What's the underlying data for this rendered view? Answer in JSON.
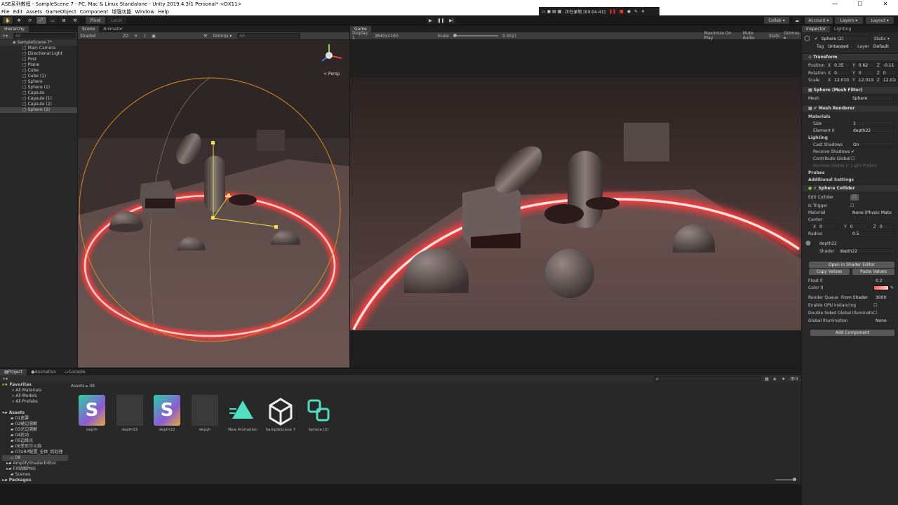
{
  "window": {
    "title": "ASE系列教程 - SampleScene 7 - PC, Mac & Linux Standalone - Unity 2019.4.3f1 Personal* <DX11>",
    "min": "—",
    "max": "☐",
    "close": "✕"
  },
  "menu": [
    "File",
    "Edit",
    "Assets",
    "GameObject",
    "Component",
    "增强功能",
    "Window",
    "Help"
  ],
  "recording": {
    "text": "正在录制 [00:04:43]"
  },
  "toolbar": {
    "pivot": "Pivot",
    "local": "Local",
    "collab": "Collab ▾",
    "account": "Account ▾",
    "layers": "Layers ▾",
    "layout": "Layout ▾"
  },
  "hierarchy": {
    "tab": "Hierarchy",
    "search_placeholder": "All",
    "scene": "SampleScene 7*",
    "items": [
      "Main Camera",
      "Directional Light",
      "Post",
      "Plane",
      "Cube",
      "Cube (1)",
      "Sphere",
      "Sphere (1)",
      "Capsule",
      "Capsule (1)",
      "Capsule (2)",
      "Sphere (2)"
    ]
  },
  "scene": {
    "tabs": [
      "Scene",
      "Animator"
    ],
    "shading": "Shaded",
    "mode": "2D",
    "gizmos": "Gizmos ▾",
    "search_placeholder": "All",
    "persp": "< Persp"
  },
  "game": {
    "tab": "Game",
    "display": "Display 1",
    "resolution": "3840x2160",
    "scale_label": "Scale",
    "scale_value": "0.502)",
    "maximize": "Maximize On Play",
    "mute": "Mute Audio",
    "stats": "Stats",
    "gizmos": "Gizmos ▾"
  },
  "inspector": {
    "tabs": [
      "Inspector",
      "Lighting"
    ],
    "object_name": "Sphere (2)",
    "static": "Static ▾",
    "tag_label": "Tag",
    "tag": "Untagged",
    "layer_label": "Layer",
    "layer": "Default",
    "transform": {
      "title": "Transform",
      "position_label": "Position",
      "px": "0.35",
      "py": "0.62",
      "pz": "-0.11",
      "rotation_label": "Rotation",
      "rx": "0",
      "ry": "0",
      "rz": "0",
      "scale_label": "Scale",
      "sx": "12.010:",
      "sy": "12.010:",
      "sz": "12.010:",
      "x": "X",
      "y": "Y",
      "z": "Z"
    },
    "mesh_filter": {
      "title": "Sphere (Mesh Filter)",
      "mesh_label": "Mesh",
      "mesh": "Sphere"
    },
    "mesh_renderer": {
      "title": "Mesh Renderer",
      "materials": "Materials",
      "size_label": "Size",
      "size": "1",
      "element_label": "Element 0",
      "element": "depth22",
      "lighting": "Lighting",
      "cast_label": "Cast Shadows",
      "cast": "On",
      "receive_label": "Receive Shadows",
      "contrib_label": "Contribute Global",
      "receive_gi_label": "Receive Global Il",
      "receive_gi": "Light Probes",
      "probes": "Probes",
      "additional": "Additional Settings"
    },
    "collider": {
      "title": "Sphere Collider",
      "edit_label": "Edit Collider",
      "trigger_label": "Is Trigger",
      "material_label": "Material",
      "material": "None (Physic Mate",
      "center_label": "Center",
      "cx": "0",
      "cy": "0",
      "cz": "0",
      "radius_label": "Radius",
      "radius": "0.5"
    },
    "material": {
      "name": "depth22",
      "shader_label": "Shader",
      "shader": "depth22",
      "open_editor": "Open in Shader Editor",
      "copy": "Copy Values",
      "paste": "Paste Values",
      "float_label": "Float 0",
      "float_val": "0.2",
      "color_label": "Color 0",
      "rq_label": "Render Queue",
      "rq_mode": "From Shader",
      "rq_val": "3000",
      "gpu_label": "Enable GPU Instancing",
      "double_label": "Double Sided Global Illuminatio",
      "gi_label": "Global Illumination",
      "gi": "None"
    },
    "add_component": "Add Component"
  },
  "project": {
    "tabs": [
      "Project",
      "Animation",
      "Console"
    ],
    "favorites": "Favorites",
    "fav_items": [
      "All Materials",
      "All Models",
      "All Prefabs"
    ],
    "assets": "Assets",
    "folders": [
      "01遮罩",
      "02硬边溶解",
      "03光边溶解",
      "04扰动",
      "05边缘光",
      "06菲尼尔火焰",
      "07URP配置_全体_后处理",
      "08",
      "AmplifyShaderEditor",
      "FX贴图PNG",
      "Scenes"
    ],
    "packages": "Packages",
    "breadcrumb": [
      "Assets",
      "08"
    ],
    "count": "9",
    "files": [
      {
        "name": "depth",
        "kind": "shader"
      },
      {
        "name": "depth22",
        "kind": "material"
      },
      {
        "name": "depth22",
        "kind": "shader"
      },
      {
        "name": "depyh",
        "kind": "material"
      },
      {
        "name": "New Animation",
        "kind": "animation"
      },
      {
        "name": "SampleScene 7",
        "kind": "unity"
      },
      {
        "name": "Sphere (2)",
        "kind": "prefab"
      }
    ]
  },
  "colors": {
    "accent": "#ff3b3b",
    "selection": "#2c5d87",
    "orange": "#e08a1e"
  }
}
